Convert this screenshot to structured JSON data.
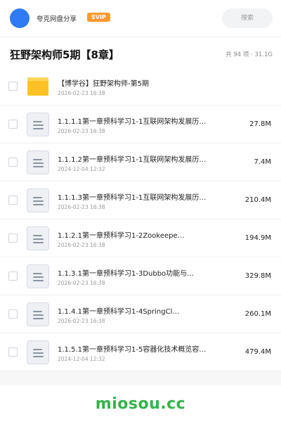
{
  "header": {
    "owner_name": "夸克网盘分享",
    "badge": "SVIP",
    "search_label": "搜索",
    "avatar_color": "#2f7bf5"
  },
  "folder": {
    "title": "狂野架构师5期【8章】",
    "summary": "共 94 项 · 31.1G"
  },
  "files": [
    {
      "type": "folder",
      "icon": "folder-icon",
      "name": "【博学谷】狂野架构师-第5期",
      "date": "2026-02-23 16:38",
      "size": ""
    },
    {
      "type": "doc",
      "icon": "document-icon",
      "name": "1.1.1.1第一章预科学习1-1互联网架构发展历…",
      "date": "2026-02-23 16:38",
      "size": "27.8M"
    },
    {
      "type": "doc",
      "icon": "document-icon",
      "name": "1.1.1.2第一章预科学习1-1互联网架构发展历…",
      "date": "2024-12-04 12:32",
      "size": "7.4M"
    },
    {
      "type": "doc",
      "icon": "document-icon",
      "name": "1.1.1.3第一章预科学习1-1互联网架构发展历…",
      "date": "2026-02-23 16:38",
      "size": "210.4M"
    },
    {
      "type": "doc",
      "icon": "document-icon",
      "name": "1.1.2.1第一章预科学习1-2Zookeepe…",
      "date": "2026-02-23 16:38",
      "size": "194.9M"
    },
    {
      "type": "doc",
      "icon": "document-icon",
      "name": "1.1.3.1第一章预科学习1-3Dubbo功能与…",
      "date": "2026-02-23 16:38",
      "size": "329.8M"
    },
    {
      "type": "doc",
      "icon": "document-icon",
      "name": "1.1.4.1第一章预科学习1-4SpringCl…",
      "date": "2026-02-23 16:38",
      "size": "260.1M"
    },
    {
      "type": "doc",
      "icon": "document-icon",
      "name": "1.1.5.1第一章预科学习1-5容器化技术概览容…",
      "date": "2024-12-04 12:32",
      "size": "479.4M"
    }
  ],
  "watermark": "miosou.cc",
  "colors": {
    "accent": "#2f7bf5",
    "badge": "#ff9a2e",
    "watermark": "#35b24a",
    "folder": "#ffc226"
  }
}
